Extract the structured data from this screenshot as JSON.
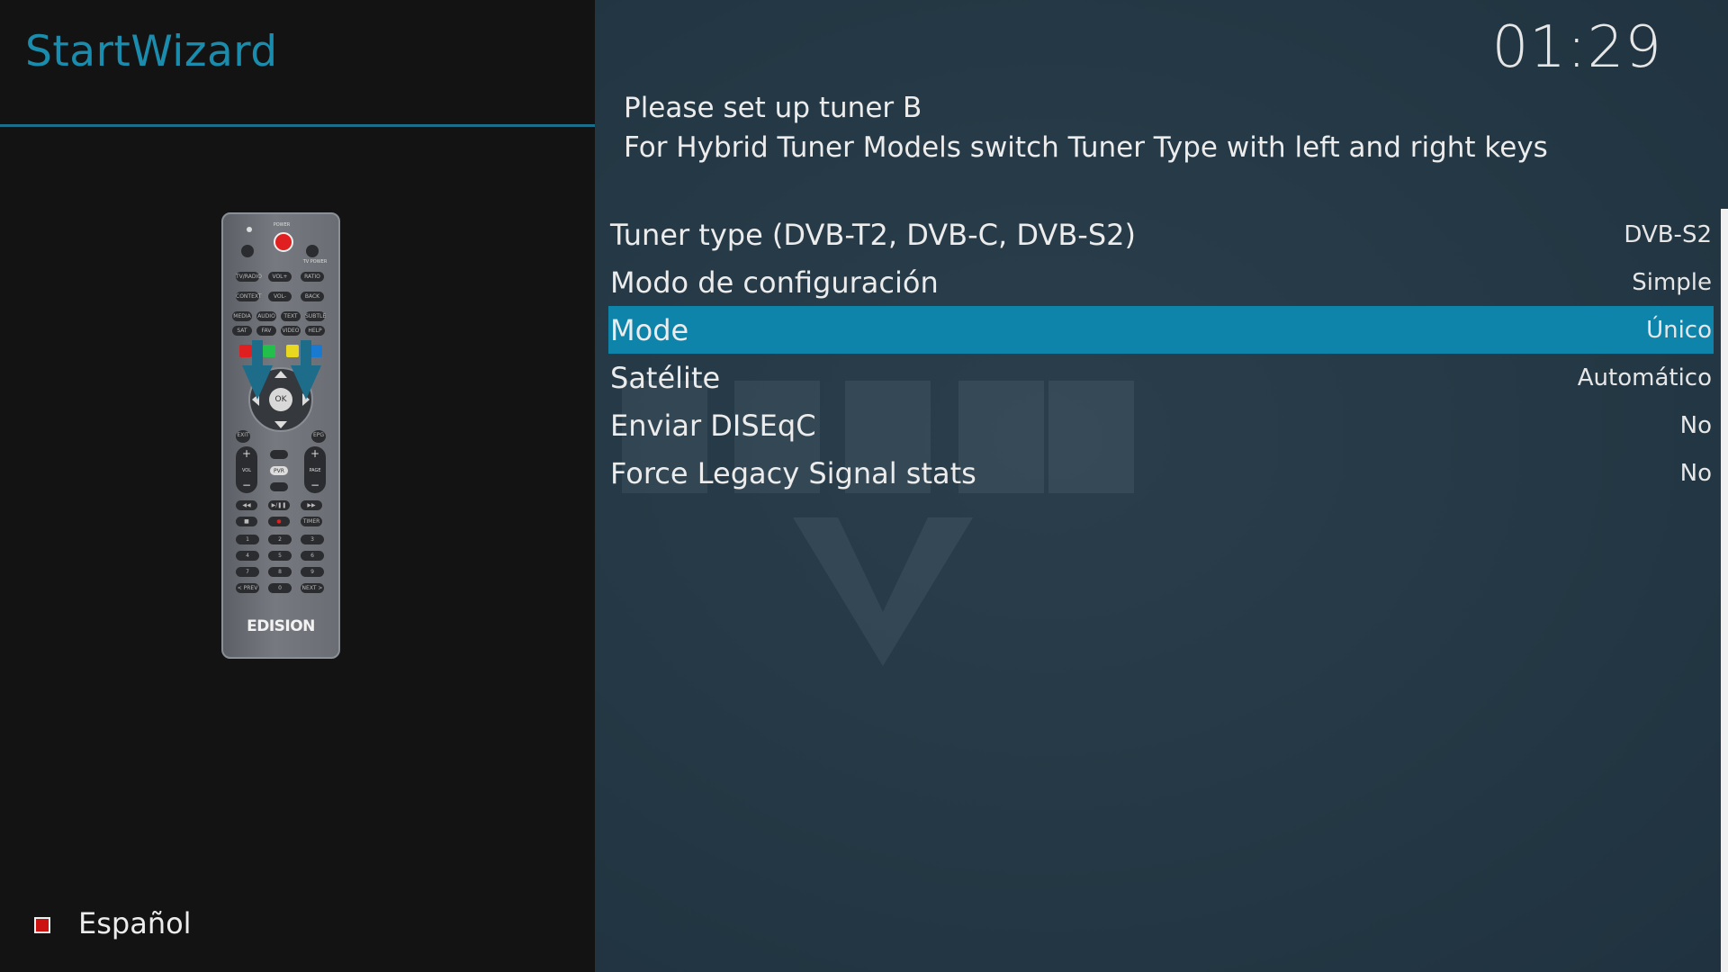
{
  "header": {
    "title": "StartWizard"
  },
  "clock": "01:29",
  "description": {
    "line1": "Please set up tuner B",
    "line2": "For Hybrid Tuner Models switch Tuner Type with left and right keys"
  },
  "settings": [
    {
      "label": "Tuner type (DVB-T2, DVB-C, DVB-S2)",
      "value": "DVB-S2"
    },
    {
      "label": "Modo de configuración",
      "value": "Simple"
    },
    {
      "label": "Mode",
      "value": "Único"
    },
    {
      "label": "Satélite",
      "value": "Automático"
    },
    {
      "label": "Enviar DISEqC",
      "value": "No"
    },
    {
      "label": "Force Legacy Signal stats",
      "value": "No"
    }
  ],
  "language": {
    "label": "Español",
    "flag_color": "#cc1111"
  },
  "remote": {
    "brand": "EDISION",
    "keys": {
      "ok": "OK",
      "power": "POWER",
      "tv_power": "TV POWER",
      "row1": [
        "TV/RADIO",
        "VOL+",
        "RATIO"
      ],
      "row2": [
        "CONTEXT",
        "VOL-",
        "BACK"
      ],
      "row3": [
        "MEDIA",
        "AUDIO",
        "TEXT",
        "SUBTLE"
      ],
      "row4": [
        "SAT",
        "FAV",
        "VIDEO",
        "HELP"
      ],
      "numbers": [
        "1",
        "2",
        "3",
        "4",
        "5",
        "6",
        "7",
        "8",
        "9",
        "0"
      ],
      "prev": "< PREV",
      "next": "NEXT >",
      "exit": "EXIT",
      "epg": "EPG",
      "timer": "TIMER",
      "pvr": "PVR",
      "vol": "VOL",
      "page": "PAGE"
    }
  },
  "colors": {
    "accent": "#0f84aa",
    "title": "#1a8dae",
    "red": "#e02020",
    "green": "#22c04a",
    "yellow": "#e8d820",
    "blue": "#1a7ad0"
  }
}
